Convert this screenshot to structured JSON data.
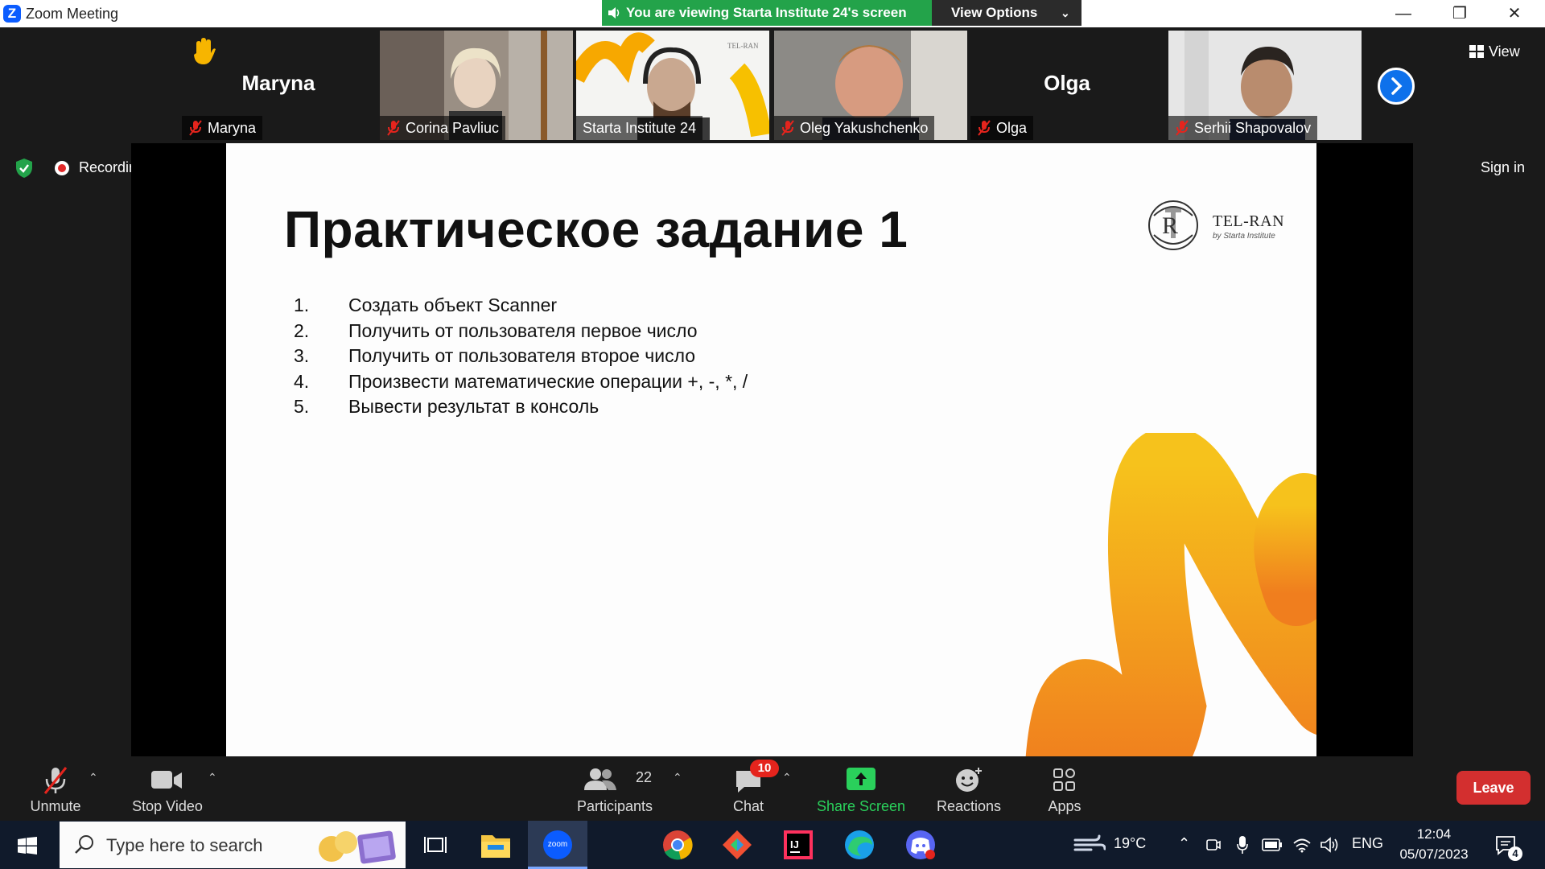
{
  "window": {
    "title": "Zoom Meeting"
  },
  "banner": {
    "viewing": "You are viewing Starta Institute 24's screen",
    "view_options": "View Options"
  },
  "participants_strip": [
    {
      "name": "Maryna",
      "label": "Maryna",
      "type": "avatar",
      "hand_raised": true
    },
    {
      "name": "Corina Pavliuc",
      "label": "Corina Pavliuc",
      "type": "video"
    },
    {
      "name": "Starta Institute 24",
      "label": "Starta Institute 24",
      "type": "video",
      "active": true
    },
    {
      "name": "Oleg Yakushchenko",
      "label": "Oleg Yakushchenko",
      "type": "video"
    },
    {
      "name": "Olga",
      "label": "Olga",
      "type": "avatar"
    },
    {
      "name": "Serhii Shapovalov",
      "label": "Serhii Shapovalov",
      "type": "video"
    }
  ],
  "top_right": {
    "view_label": "View",
    "sign_in": "Sign in"
  },
  "status": {
    "recording": "Recording"
  },
  "slide": {
    "title": "Практическое задание 1",
    "items": [
      {
        "num": "1.",
        "text": "Создать объект Scanner"
      },
      {
        "num": "2.",
        "text": "Получить от пользователя первое число"
      },
      {
        "num": "3.",
        "text": "Получить от пользователя второе число"
      },
      {
        "num": "4.",
        "text": "Произвести математические операции +, -, *, /"
      },
      {
        "num": "5.",
        "text": "Вывести результат в консоль"
      }
    ],
    "logo_name": "TEL-RAN",
    "logo_sub": "by Starta Institute"
  },
  "toolbar": {
    "unmute": "Unmute",
    "stop_video": "Stop Video",
    "participants": "Participants",
    "participants_count": "22",
    "chat": "Chat",
    "chat_badge": "10",
    "share_screen": "Share Screen",
    "reactions": "Reactions",
    "apps": "Apps",
    "leave": "Leave"
  },
  "taskbar": {
    "search_placeholder": "Type here to search",
    "weather": "19°C",
    "lang": "ENG",
    "time": "12:04",
    "date": "05/07/2023",
    "notifications": "4"
  },
  "colors": {
    "accent_green": "#23a34a",
    "zoom_blue": "#0e71eb",
    "leave_red": "#d32f2f",
    "share_green": "#2ad05b"
  }
}
